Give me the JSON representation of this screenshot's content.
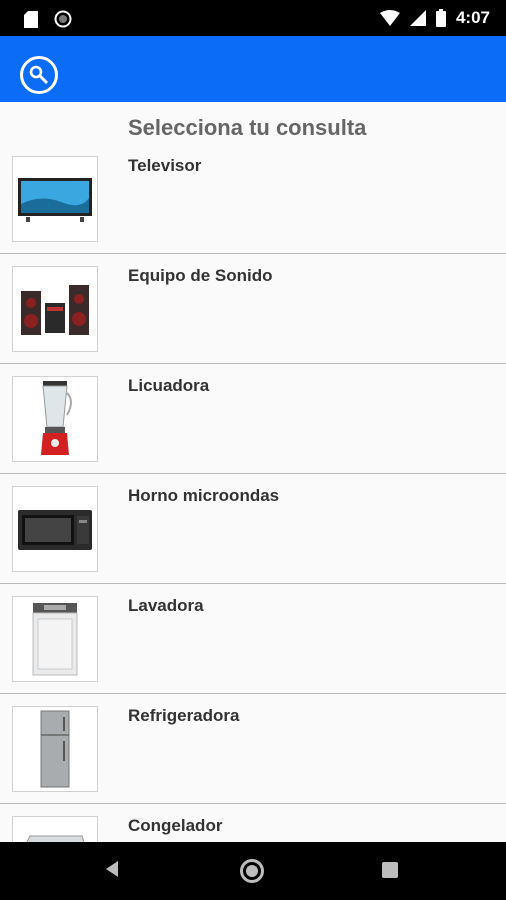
{
  "status_bar": {
    "time": "4:07",
    "icons": [
      "sd-card-icon",
      "circle-notification-icon",
      "wifi-icon",
      "signal-icon",
      "battery-icon"
    ]
  },
  "app_bar": {
    "color": "#0a6cf7",
    "action_icon": "search-key-icon"
  },
  "page": {
    "title": "Selecciona tu consulta"
  },
  "items": [
    {
      "label": "Televisor",
      "icon": "tv-icon"
    },
    {
      "label": "Equipo de Sonido",
      "icon": "speakers-icon"
    },
    {
      "label": "Licuadora",
      "icon": "blender-icon"
    },
    {
      "label": "Horno microondas",
      "icon": "microwave-icon"
    },
    {
      "label": "Lavadora",
      "icon": "washing-machine-icon"
    },
    {
      "label": "Refrigeradora",
      "icon": "refrigerator-icon"
    },
    {
      "label": "Congelador",
      "icon": "freezer-icon"
    }
  ],
  "nav_bar": {
    "buttons": [
      "back-icon",
      "home-icon",
      "recent-apps-icon"
    ]
  }
}
